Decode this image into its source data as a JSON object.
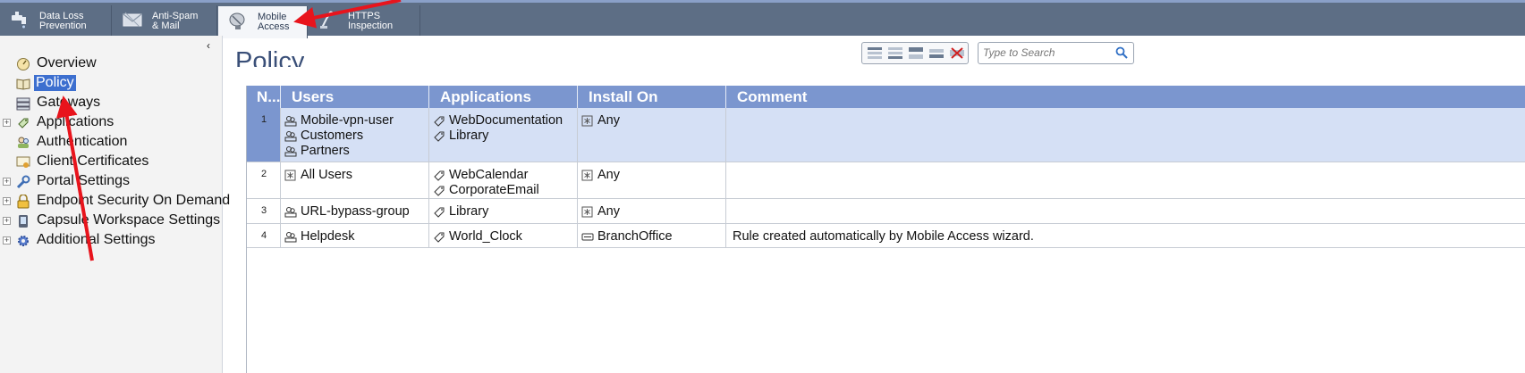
{
  "tabs": [
    {
      "label": "Data Loss\nPrevention",
      "icon": "faucet-icon"
    },
    {
      "label": "Anti-Spam\n& Mail",
      "icon": "envelope-icon"
    },
    {
      "label": "Mobile\nAccess",
      "icon": "satellite-dish-icon",
      "active": true
    },
    {
      "label": "HTTPS\nInspection",
      "icon": "probe-icon"
    }
  ],
  "sidebar": {
    "collapse_glyph": "‹",
    "items": [
      {
        "label": "Overview",
        "icon": "overview-icon",
        "expandable": false
      },
      {
        "label": "Policy",
        "icon": "policy-book-icon",
        "expandable": false,
        "selected": true
      },
      {
        "label": "Gateways",
        "icon": "gateway-icon",
        "expandable": false
      },
      {
        "label": "Applications",
        "icon": "application-icon",
        "expandable": true
      },
      {
        "label": "Authentication",
        "icon": "authentication-icon",
        "expandable": false
      },
      {
        "label": "Client Certificates",
        "icon": "certificate-icon",
        "expandable": false
      },
      {
        "label": "Portal Settings",
        "icon": "wrench-icon",
        "expandable": true
      },
      {
        "label": "Endpoint Security On Demand",
        "icon": "lock-icon",
        "expandable": true
      },
      {
        "label": "Capsule Workspace Settings",
        "icon": "mobile-device-icon",
        "expandable": true
      },
      {
        "label": "Additional Settings",
        "icon": "gear-icon",
        "expandable": true
      }
    ],
    "expand_glyph": "+"
  },
  "main": {
    "title": "Policy",
    "search_placeholder": "Type to Search"
  },
  "table": {
    "columns": [
      "N...",
      "Users",
      "Applications",
      "Install On",
      "Comment"
    ],
    "rows": [
      {
        "num": "1",
        "users": [
          "Mobile-vpn-user",
          "Customers",
          "Partners"
        ],
        "applications": [
          "WebDocumentation",
          "Library"
        ],
        "install_on": [
          "Any"
        ],
        "comment": ""
      },
      {
        "num": "2",
        "users": [
          "All Users"
        ],
        "applications": [
          "WebCalendar",
          "CorporateEmail"
        ],
        "install_on": [
          "Any"
        ],
        "comment": ""
      },
      {
        "num": "3",
        "users": [
          "URL-bypass-group"
        ],
        "applications": [
          "Library"
        ],
        "install_on": [
          "Any"
        ],
        "comment": ""
      },
      {
        "num": "4",
        "users": [
          "Helpdesk"
        ],
        "applications": [
          "World_Clock"
        ],
        "install_on": [
          "BranchOffice"
        ],
        "comment": "Rule created automatically by Mobile Access wizard."
      }
    ]
  },
  "colors": {
    "header_blue": "#7b96cf",
    "selected_row": "#d5e0f5",
    "annotation_arrow": "#e8141c"
  }
}
